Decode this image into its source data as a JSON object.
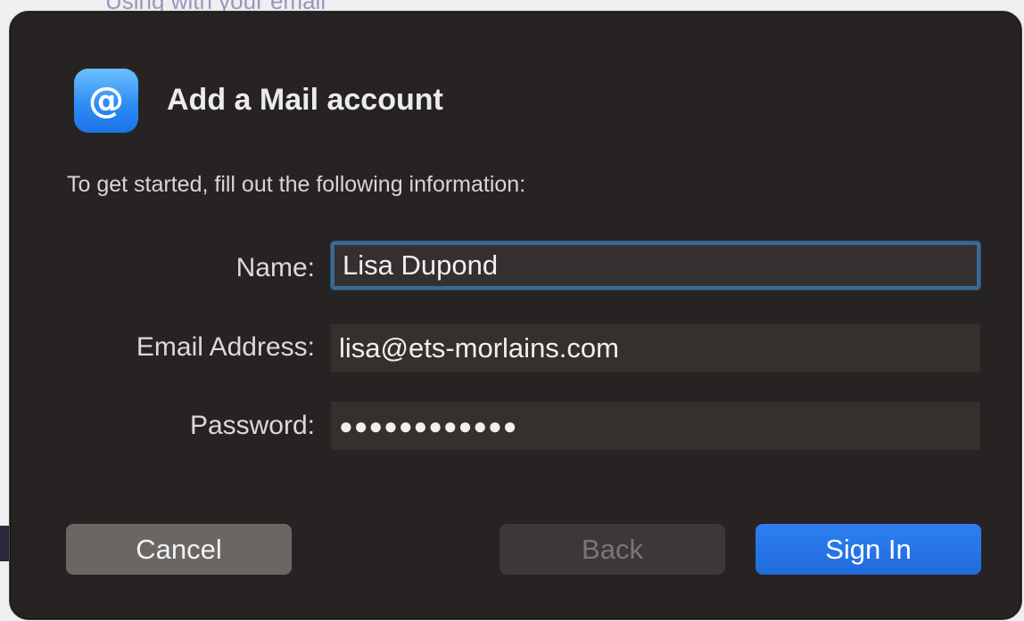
{
  "backdrop": {
    "partial_text": "Using with your email"
  },
  "dialog": {
    "title": "Add a Mail account",
    "icon": "at-sign-icon",
    "intro": "To get started, fill out the following information:",
    "fields": {
      "name": {
        "label": "Name:",
        "value": "Lisa Dupond"
      },
      "email": {
        "label": "Email Address:",
        "value": "lisa@ets-morlains.com"
      },
      "password": {
        "label": "Password:",
        "value": "●●●●●●●●●●●●"
      }
    },
    "buttons": {
      "cancel": "Cancel",
      "back": "Back",
      "sign_in": "Sign In"
    },
    "colors": {
      "accent": "#1f6bdc",
      "focus_ring": "#3a6b95",
      "dialog_bg": "#272322"
    }
  }
}
